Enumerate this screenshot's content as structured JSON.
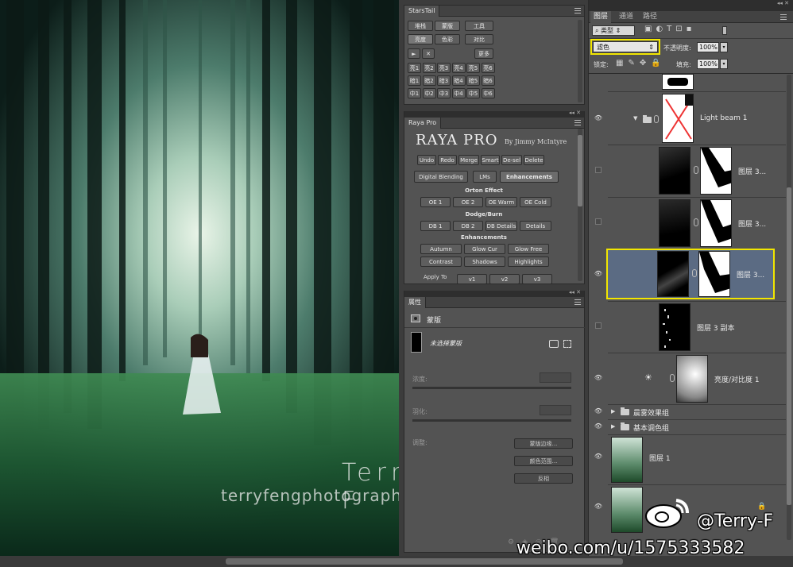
{
  "watermark": {
    "name": "Terry F",
    "site": "terryfengphotography.lofter.com"
  },
  "starstail": {
    "title": "StarsTail",
    "row1": [
      "堆栈",
      "蒙版",
      "工具"
    ],
    "row2": [
      "亮度",
      "色彩",
      "对比"
    ],
    "play": "►",
    "stop": "✕",
    "more": "更多",
    "grid": [
      [
        "亮1",
        "亮2",
        "亮3",
        "亮4",
        "亮5",
        "亮6"
      ],
      [
        "暗1",
        "暗2",
        "暗3",
        "暗4",
        "暗5",
        "暗6"
      ],
      [
        "中1",
        "中2",
        "中3",
        "中4",
        "中5",
        "中6"
      ]
    ]
  },
  "raya": {
    "tab": "Raya Pro",
    "brand": "RAYA PRO",
    "byline": "By Jimmy McIntyre",
    "toolbar": [
      "Undo",
      "Redo",
      "Merge",
      "Smart",
      "De-sel",
      "Delete"
    ],
    "tabs": [
      "Digital Blending",
      "LMs",
      "Enhancements"
    ],
    "orton_title": "Orton Effect",
    "orton": [
      "OE 1",
      "OE 2",
      "OE Warm",
      "OE Cold"
    ],
    "dodge_title": "Dodge/Burn",
    "dodge": [
      "DB 1",
      "DB 2",
      "DB Details",
      "Details"
    ],
    "enh_title": "Enhancements",
    "enh1": [
      "Autumn",
      "Glow Cur",
      "Glow Free"
    ],
    "enh2": [
      "Contrast",
      "Shadows",
      "Highlights"
    ],
    "apply_to": "Apply To",
    "apply": [
      "v1",
      "v2",
      "v3"
    ]
  },
  "properties": {
    "tab": "属性",
    "type_label": "蒙版",
    "status": "未选择蒙版",
    "density_label": "浓度:",
    "feather_label": "羽化:",
    "adjust_label": "调整:",
    "buttons": [
      "蒙版边缘...",
      "颜色范围...",
      "反相"
    ]
  },
  "layers_panel": {
    "tabs": [
      "图层",
      "通道",
      "路径"
    ],
    "filter_kind": "类型",
    "blend_mode": "滤色",
    "opacity_label": "不透明度:",
    "opacity_value": "100%",
    "lock_label": "锁定:",
    "fill_label": "填充:",
    "fill_value": "100%",
    "layers": [
      {
        "name": "Light beam 1"
      },
      {
        "name": "图层 3..."
      },
      {
        "name": "图层 3..."
      },
      {
        "name": "图层 3..."
      },
      {
        "name": "图层 3 副本"
      },
      {
        "name": "亮度/对比度 1"
      },
      {
        "name": "晨雾效果组"
      },
      {
        "name": "基本调色组"
      },
      {
        "name": "图层 1"
      }
    ]
  },
  "weibo": {
    "handle": "@Terry-F",
    "url": "weibo.com/u/1575333582"
  },
  "colors": {
    "highlight": "#f2e600",
    "selected_row": "#5b6b83"
  }
}
